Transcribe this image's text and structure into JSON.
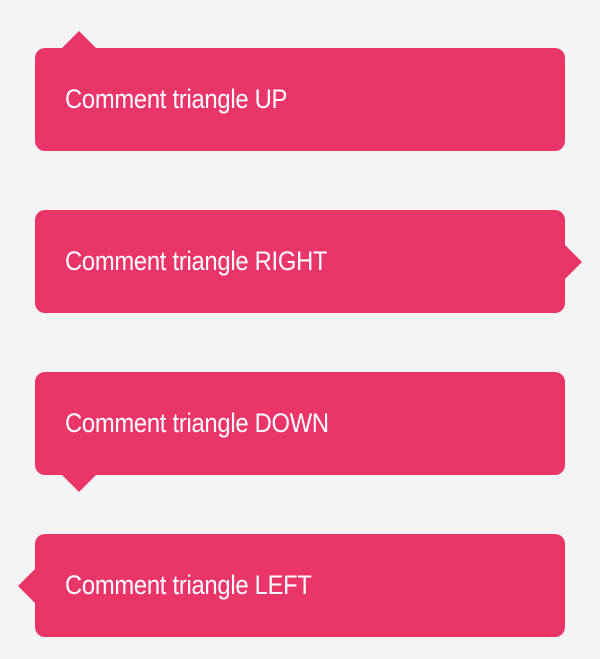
{
  "colors": {
    "background": "#f4f4f4",
    "bubble": "#ea3569",
    "text": "#ffffff"
  },
  "bubbles": [
    {
      "label": "Comment triangle UP",
      "pointer": "up"
    },
    {
      "label": "Comment triangle RIGHT",
      "pointer": "right"
    },
    {
      "label": "Comment triangle DOWN",
      "pointer": "down"
    },
    {
      "label": "Comment triangle LEFT",
      "pointer": "left"
    }
  ]
}
